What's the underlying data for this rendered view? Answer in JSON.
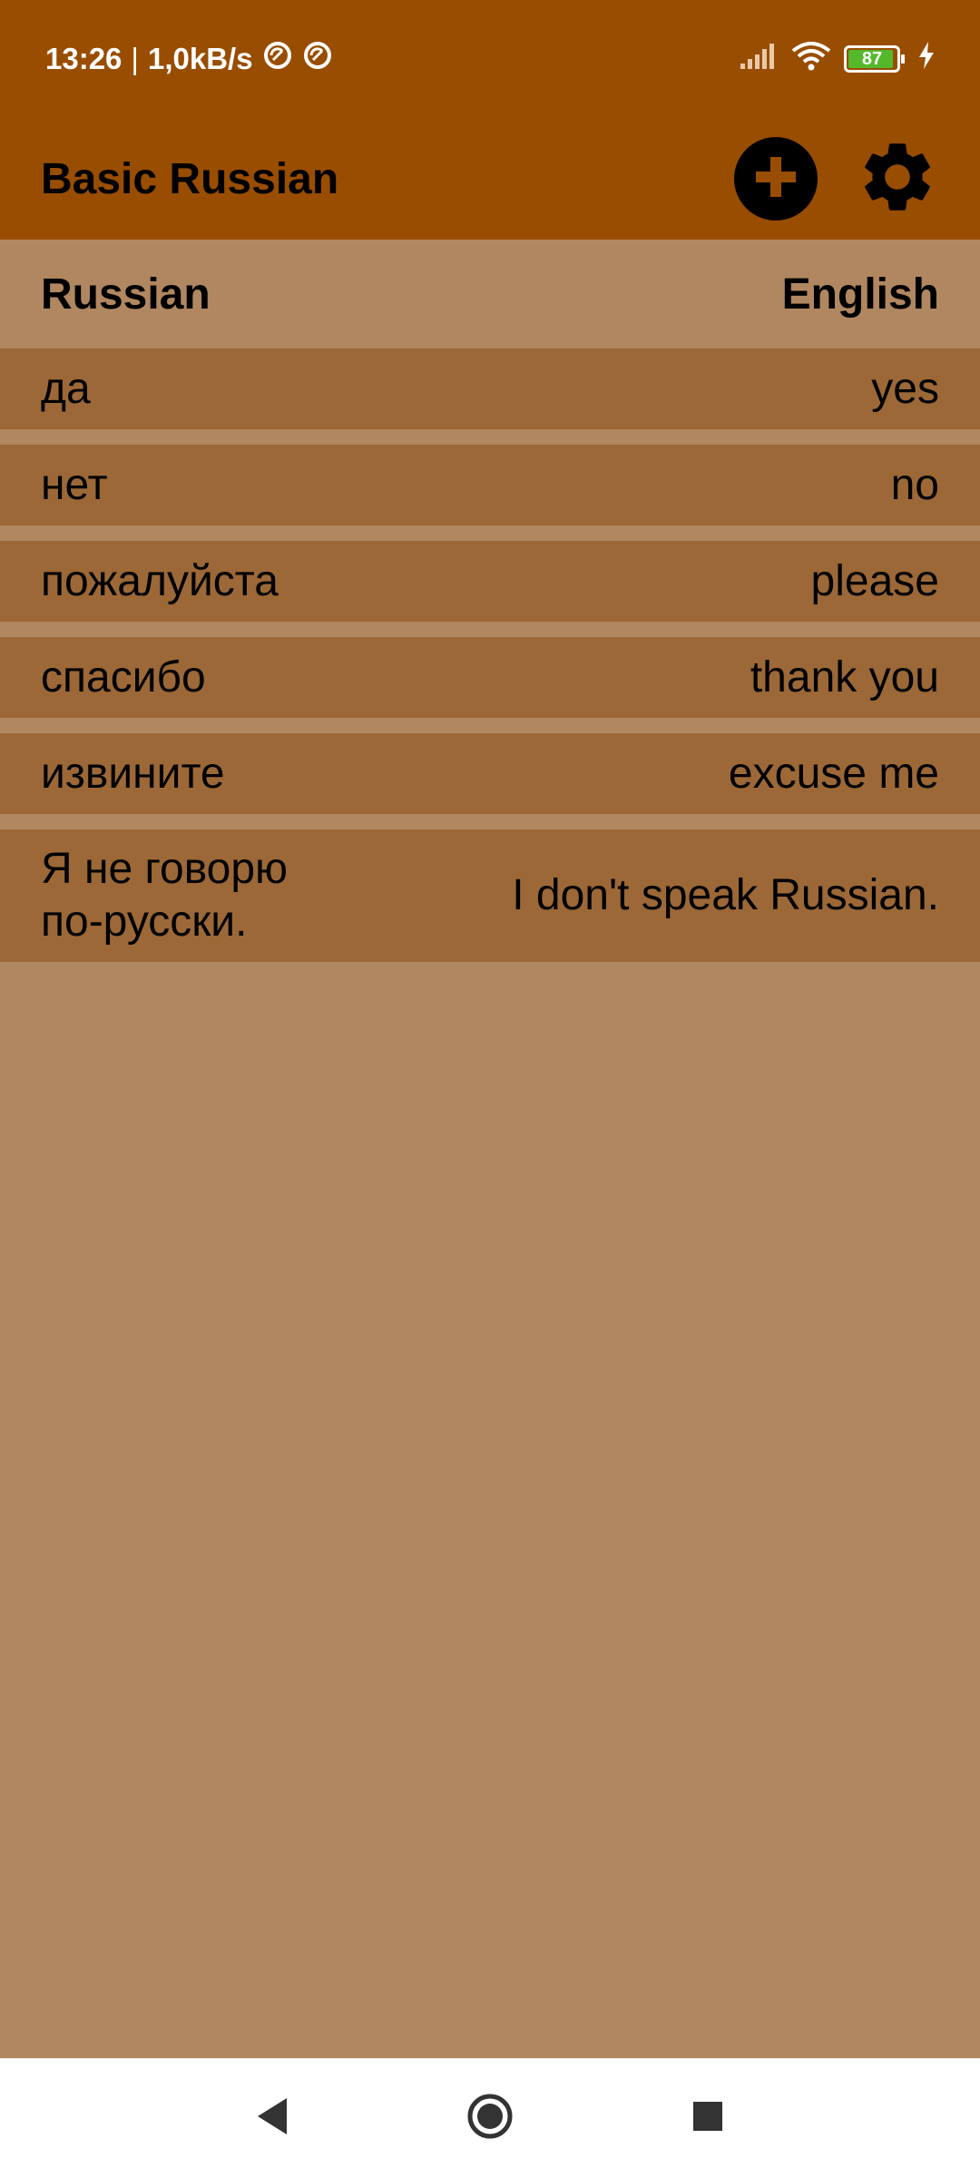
{
  "status_bar": {
    "time": "13:26",
    "separator": "|",
    "speed": "1,0kB/s",
    "battery": "87"
  },
  "app": {
    "title": "Basic Russian"
  },
  "columns": {
    "left": "Russian",
    "right": "English"
  },
  "words": [
    {
      "ru": "да",
      "en": "yes"
    },
    {
      "ru": "нет",
      "en": "no"
    },
    {
      "ru": "пожалуйста",
      "en": "please"
    },
    {
      "ru": "спасибо",
      "en": "thank you"
    },
    {
      "ru": "извините",
      "en": "excuse me"
    },
    {
      "ru": "Я не говорю по-русски.",
      "en": "I don't speak Russian."
    }
  ],
  "colors": {
    "bar": "#994d00",
    "background": "#b08760",
    "row": "#9c6837"
  },
  "icons": {
    "add": "add-icon",
    "settings": "gear-icon",
    "back": "back-icon",
    "home": "home-icon",
    "recents": "recents-icon"
  }
}
